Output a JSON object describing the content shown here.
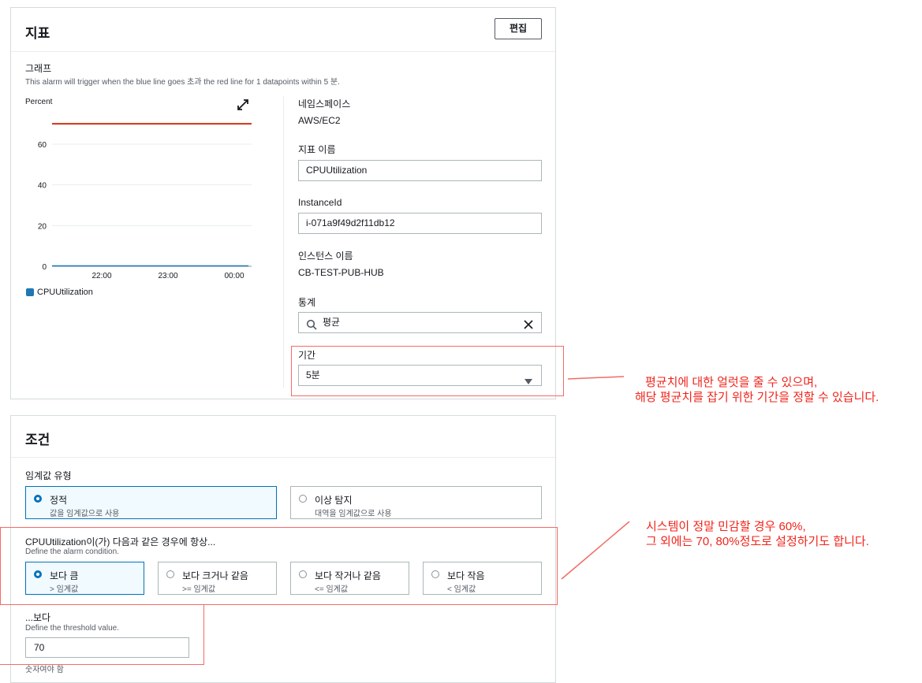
{
  "metrics_panel": {
    "title": "지표",
    "edit_label": "편집",
    "graph_label": "그래프",
    "graph_desc": "This alarm will trigger when the blue line goes 초과 the red line for 1 datapoints within 5 분.",
    "chart": {
      "unit_label": "Percent",
      "legend": "CPUUtilization",
      "expand_icon": "expand-icon"
    },
    "namespace_label": "네임스페이스",
    "namespace_value": "AWS/EC2",
    "metric_name_label": "지표 이름",
    "metric_name_value": "CPUUtilization",
    "instance_id_label": "InstanceId",
    "instance_id_value": "i-071a9f49d2f11db12",
    "instance_name_label": "인스턴스 이름",
    "instance_name_value": "CB-TEST-PUB-HUB",
    "statistic_label": "통계",
    "statistic_value": "평균",
    "period_label": "기간",
    "period_value": "5분"
  },
  "chart_data": {
    "type": "line",
    "ylabel": "Percent",
    "ylim": [
      0,
      70
    ],
    "y_ticks": [
      "60",
      "40",
      "20",
      "0"
    ],
    "x_ticks": [
      "22:00",
      "23:00",
      "00:00"
    ],
    "series": [
      {
        "name": "CPUUtilization",
        "color": "#1f77b4",
        "values": [
          0.2,
          0.2,
          0.2,
          0.2,
          0.2,
          0.2,
          0.2
        ]
      }
    ],
    "threshold": {
      "value": 70,
      "color": "#d13212"
    },
    "grid": true,
    "legend_position": "bottom-left"
  },
  "conditions_panel": {
    "title": "조건",
    "threshold_type_label": "임계값 유형",
    "threshold_types": [
      {
        "title": "정적",
        "desc": "값을 임계값으로 사용",
        "selected": true
      },
      {
        "title": "이상 탐지",
        "desc": "대역을 임계값으로 사용",
        "selected": false
      }
    ],
    "condition_label": "CPUUtilization이(가) 다음과 같은 경우에 항상...",
    "condition_desc": "Define the alarm condition.",
    "operators": [
      {
        "title": "보다 큼",
        "desc": "> 임계값",
        "selected": true
      },
      {
        "title": "보다 크거나 같음",
        "desc": ">= 임계값",
        "selected": false
      },
      {
        "title": "보다 작거나 같음",
        "desc": "<= 임계값",
        "selected": false
      },
      {
        "title": "보다 작음",
        "desc": "< 임계값",
        "selected": false
      }
    ],
    "threshold_label": "...보다",
    "threshold_desc": "Define the threshold value.",
    "threshold_value": "70",
    "threshold_hint": "숫자여야 함"
  },
  "annotations": {
    "note1_line1": "평균치에 대한 얼럿을 줄 수 있으며,",
    "note1_line2": "해당 평균치를 잡기 위한 기간을 정할 수 있습니다.",
    "note2_line1": "시스템이 정말 민감할 경우 60%,",
    "note2_line2": "그 외에는 70, 80%정도로 설정하기도 합니다."
  },
  "colors": {
    "accent": "#0073bb",
    "annotation": "#f0241b",
    "highlight_box": "#f36b66"
  }
}
